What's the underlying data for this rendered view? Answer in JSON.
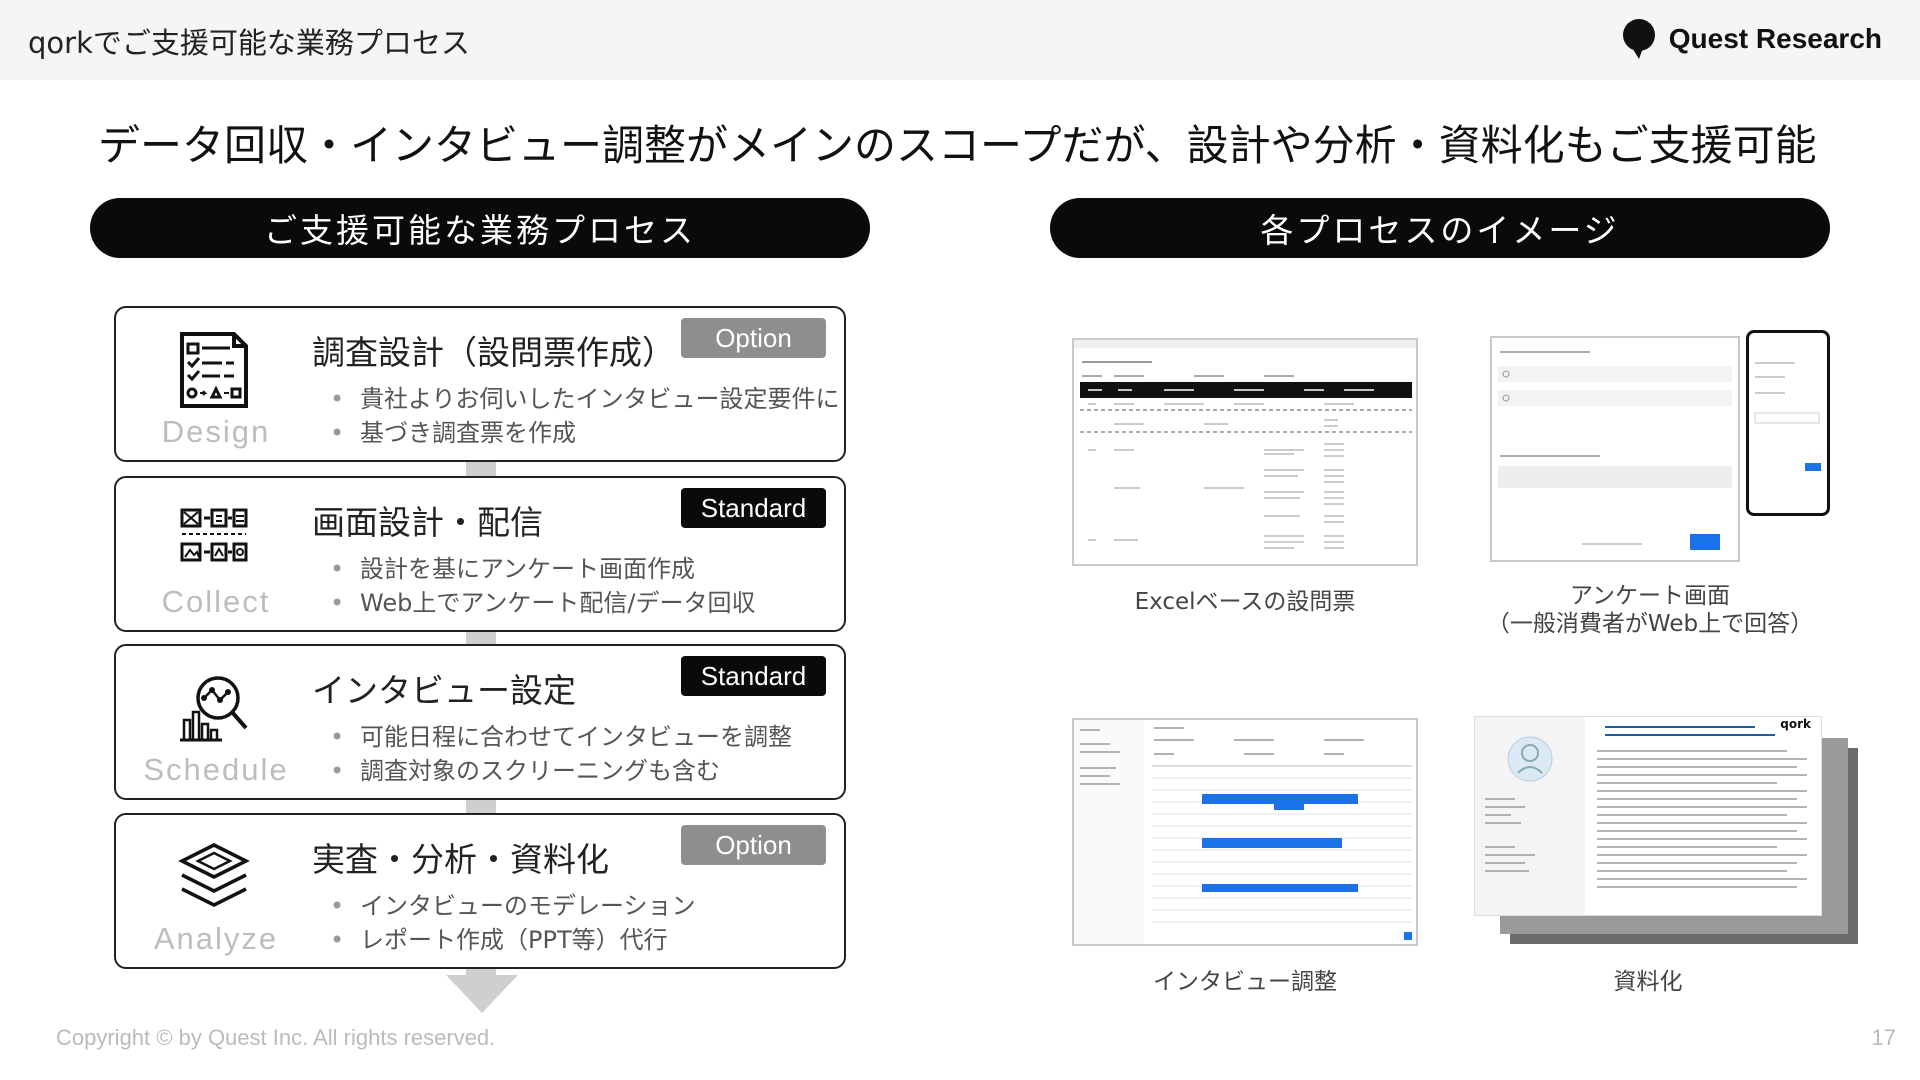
{
  "header": {
    "title": "qorkでご支援可能な業務プロセス",
    "brand": "Quest Research",
    "brand_icon": "speech-bubble-logo-icon"
  },
  "headline": "データ回収・インタビュー調整がメインのスコープだが、設計や分析・資料化もご支援可能",
  "sections": {
    "left": "ご支援可能な業務プロセス",
    "right": "各プロセスのイメージ"
  },
  "processes": [
    {
      "name": "Design",
      "title": "調査設計（設問票作成）",
      "badge": "Option",
      "icon": "survey-form-icon",
      "bullets": [
        "貴社よりお伺いしたインタビュー設定要件に",
        "基づき調査票を作成"
      ]
    },
    {
      "name": "Collect",
      "title": "画面設計・配信",
      "badge": "Standard",
      "icon": "screen-layout-icon",
      "bullets": [
        "設計を基にアンケート画面作成",
        "Web上でアンケート配信/データ回収"
      ]
    },
    {
      "name": "Schedule",
      "title": "インタビュー設定",
      "badge": "Standard",
      "icon": "analytics-search-icon",
      "bullets": [
        "可能日程に合わせてインタビューを調整",
        "調査対象のスクリーニングも含む"
      ]
    },
    {
      "name": "Analyze",
      "title": "実査・分析・資料化",
      "badge": "Option",
      "icon": "layers-icon",
      "bullets": [
        "インタビューのモデレーション",
        "レポート作成（PPT等）代行"
      ]
    }
  ],
  "images": [
    {
      "caption": "Excelベースの設問票"
    },
    {
      "caption_line1": "アンケート画面",
      "caption_line2": "（一般消費者がWeb上で回答）"
    },
    {
      "caption": "インタビュー調整"
    },
    {
      "caption": "資料化",
      "logo": "qork"
    }
  ],
  "footer": {
    "copyright": "Copyright © by Quest Inc. All rights reserved.",
    "page": "17"
  },
  "colors": {
    "badge_option": "#8e8e8e",
    "badge_standard": "#0a0a0a",
    "accent_blue": "#1a73e8"
  }
}
